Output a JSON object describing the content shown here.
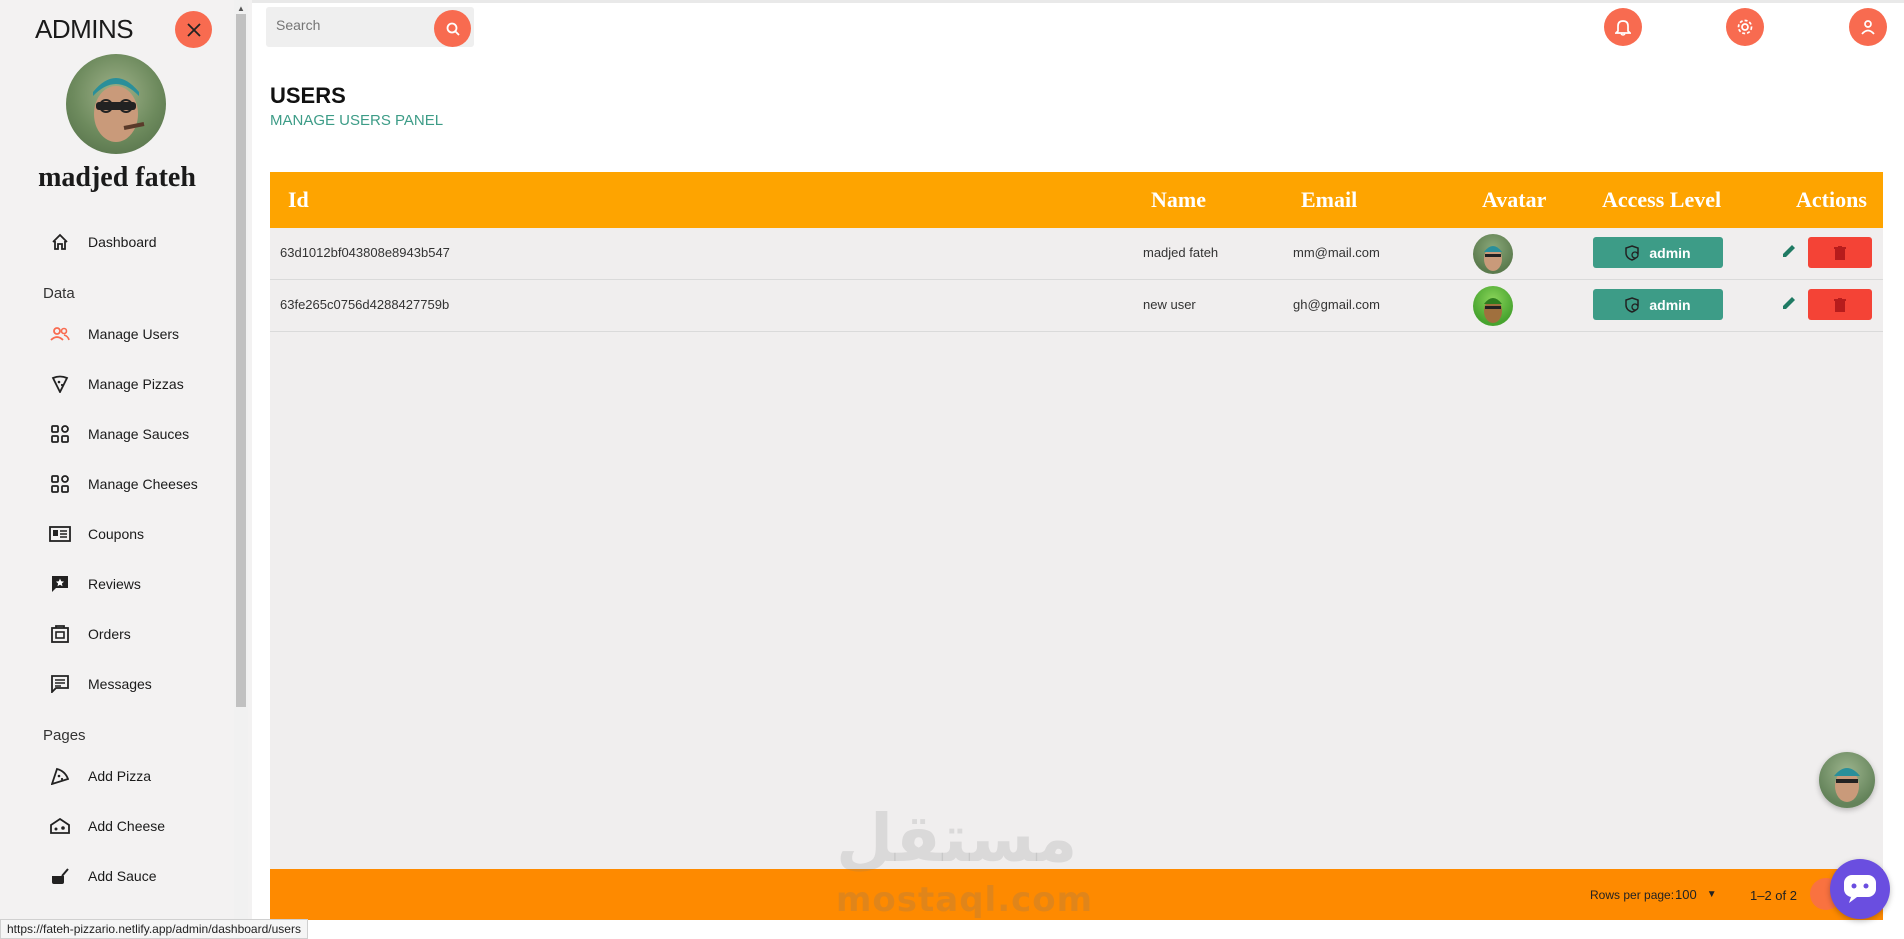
{
  "sidebar": {
    "title": "ADMINS",
    "profile_name": "madjed fateh",
    "sections": [
      {
        "label": "Data"
      },
      {
        "label": "Pages"
      }
    ],
    "items": [
      {
        "label": "Dashboard",
        "icon": "home-icon"
      },
      {
        "label": "Manage Users",
        "icon": "users-icon"
      },
      {
        "label": "Manage Pizzas",
        "icon": "pizza-icon"
      },
      {
        "label": "Manage Sauces",
        "icon": "grid-icon"
      },
      {
        "label": "Manage Cheeses",
        "icon": "grid-icon"
      },
      {
        "label": "Coupons",
        "icon": "coupon-icon"
      },
      {
        "label": "Reviews",
        "icon": "review-icon"
      },
      {
        "label": "Orders",
        "icon": "orders-icon"
      },
      {
        "label": "Messages",
        "icon": "message-icon"
      },
      {
        "label": "Add Pizza",
        "icon": "pizza-slice-icon"
      },
      {
        "label": "Add Cheese",
        "icon": "cheese-icon"
      },
      {
        "label": "Add Sauce",
        "icon": "sauce-icon"
      }
    ]
  },
  "header": {
    "search_placeholder": "Search"
  },
  "page": {
    "title": "USERS",
    "subtitle": "MANAGE USERS PANEL"
  },
  "table": {
    "columns": [
      "Id",
      "Name",
      "Email",
      "Avatar",
      "Access Level",
      "Actions"
    ],
    "rows": [
      {
        "id": "63d1012bf043808e8943b547",
        "name": "madjed fateh",
        "email": "mm@mail.com",
        "access": "admin"
      },
      {
        "id": "63fe265c0756d4288427759b",
        "name": "new user",
        "email": "gh@gmail.com",
        "access": "admin"
      }
    ],
    "footer": {
      "rows_per_page_label": "Rows per page:",
      "rows_per_page_value": "100",
      "page_info": "1–2 of 2"
    }
  },
  "watermark": {
    "arabic": "مستقل",
    "latin": "mostaql.com"
  },
  "status_url": "https://fateh-pizzario.netlify.app/admin/dashboard/users",
  "colors": {
    "accent": "#f86b50",
    "header_orange": "#fea400",
    "footer_orange": "#fe8a00",
    "teal": "#3d9c87",
    "delete_red": "#f44336",
    "chat_purple": "#6a4ee0"
  }
}
